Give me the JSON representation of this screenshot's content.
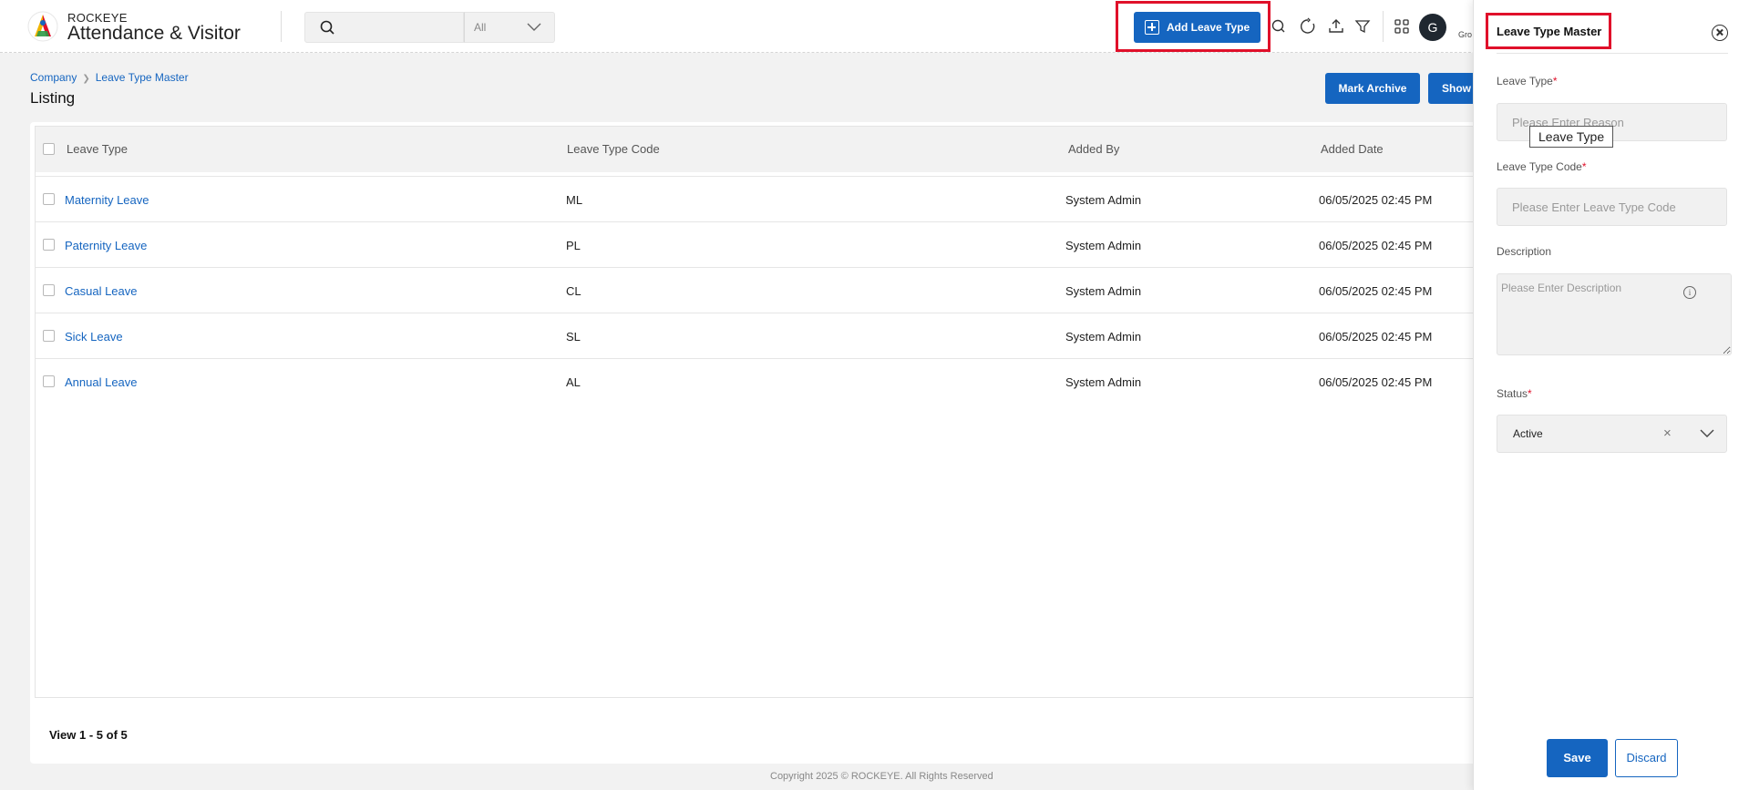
{
  "header": {
    "brand_top": "ROCKEYE",
    "brand_main": "Attendance & Visitor",
    "search": {
      "value": "",
      "placeholder": ""
    },
    "scope_select": "All",
    "add_button": "Add Leave Type",
    "avatar_initial": "G",
    "user_fragment": "Gro",
    "icons": [
      "search-icon",
      "refresh-icon",
      "upload-icon",
      "filter-icon",
      "apps-grid-icon"
    ]
  },
  "breadcrumb": {
    "items": [
      "Company",
      "Leave Type Master"
    ]
  },
  "page_title": "Listing",
  "toolbar": {
    "archive_button": "Mark Archive",
    "show_button": "Show"
  },
  "table": {
    "headers": [
      "Leave Type",
      "Leave Type Code",
      "Added By",
      "Added Date"
    ],
    "rows": [
      {
        "leave_type": "Maternity Leave",
        "code": "ML",
        "added_by": "System Admin",
        "added_date": "06/05/2025 02:45 PM"
      },
      {
        "leave_type": "Paternity Leave",
        "code": "PL",
        "added_by": "System Admin",
        "added_date": "06/05/2025 02:45 PM"
      },
      {
        "leave_type": "Casual Leave",
        "code": "CL",
        "added_by": "System Admin",
        "added_date": "06/05/2025 02:45 PM"
      },
      {
        "leave_type": "Sick Leave",
        "code": "SL",
        "added_by": "System Admin",
        "added_date": "06/05/2025 02:45 PM"
      },
      {
        "leave_type": "Annual Leave",
        "code": "AL",
        "added_by": "System Admin",
        "added_date": "06/05/2025 02:45 PM"
      }
    ],
    "footer": "View 1 - 5 of 5"
  },
  "copyright": "Copyright 2025 © ROCKEYE. All Rights Reserved",
  "panel": {
    "title": "Leave Type Master",
    "fields": {
      "leave_type": {
        "label": "Leave Type",
        "required": "*",
        "value": "",
        "placeholder": "Please Enter Reason",
        "tooltip": "Leave Type"
      },
      "leave_type_code": {
        "label": "Leave Type Code",
        "required": "*",
        "value": "",
        "placeholder": "Please Enter Leave Type Code"
      },
      "description": {
        "label": "Description",
        "value": "",
        "placeholder": "Please Enter Description"
      },
      "status": {
        "label": "Status",
        "required": "*",
        "value": "Active",
        "clear": "×"
      }
    },
    "save_button": "Save",
    "discard_button": "Discard"
  },
  "colors": {
    "primary": "#1565c0",
    "highlight": "#e0102a"
  }
}
